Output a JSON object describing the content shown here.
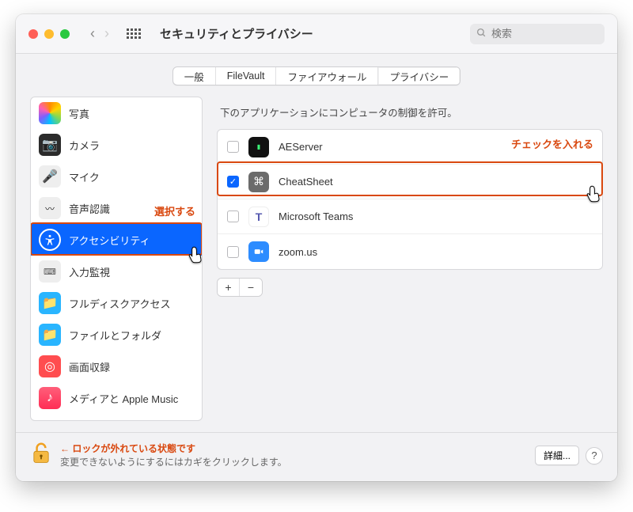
{
  "window": {
    "title": "セキュリティとプライバシー"
  },
  "search": {
    "placeholder": "検索"
  },
  "tabs": [
    {
      "label": "一般"
    },
    {
      "label": "FileVault"
    },
    {
      "label": "ファイアウォール"
    },
    {
      "label": "プライバシー",
      "active": true
    }
  ],
  "sidebar": {
    "items": [
      {
        "label": "写真"
      },
      {
        "label": "カメラ"
      },
      {
        "label": "マイク"
      },
      {
        "label": "音声認識"
      },
      {
        "label": "アクセシビリティ",
        "selected": true
      },
      {
        "label": "入力監視"
      },
      {
        "label": "フルディスクアクセス"
      },
      {
        "label": "ファイルとフォルダ"
      },
      {
        "label": "画面収録"
      },
      {
        "label": "メディアと Apple Music"
      }
    ]
  },
  "main": {
    "description": "下のアプリケーションにコンピュータの制御を許可。",
    "apps": [
      {
        "name": "AEServer",
        "checked": false
      },
      {
        "name": "CheatSheet",
        "checked": true
      },
      {
        "name": "Microsoft Teams",
        "checked": false
      },
      {
        "name": "zoom.us",
        "checked": false
      }
    ]
  },
  "footer": {
    "title": "← ロックが外れている状態です",
    "subtitle": "変更できないようにするにはカギをクリックします。",
    "details_button": "詳細..."
  },
  "annotations": {
    "select_label": "選択する",
    "check_label": "チェックを入れる"
  }
}
